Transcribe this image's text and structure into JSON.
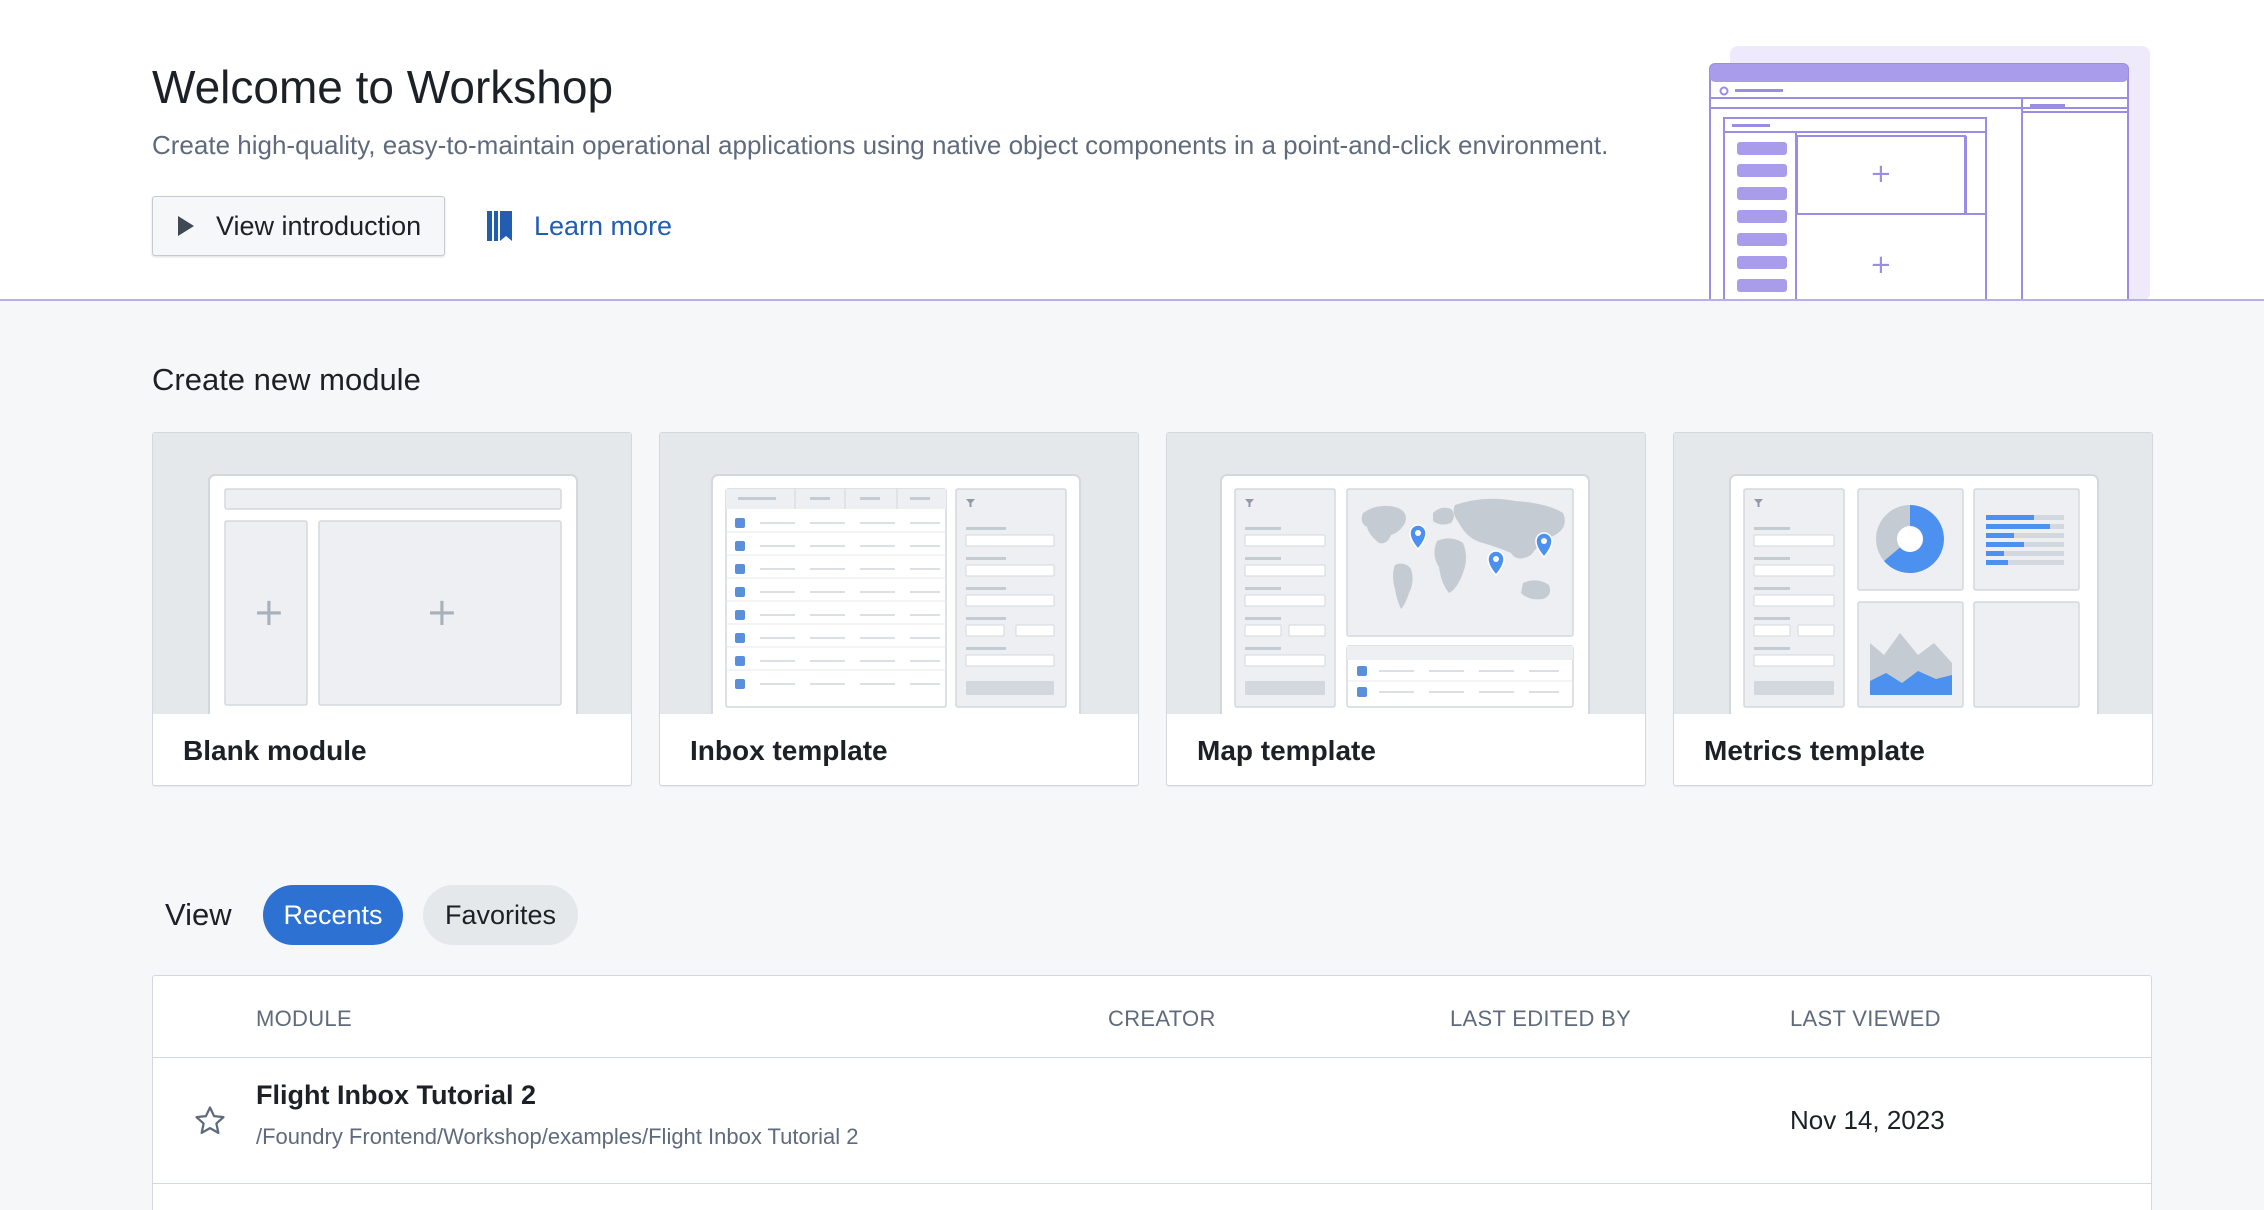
{
  "header": {
    "title": "Welcome to Workshop",
    "subtitle": "Create high-quality, easy-to-maintain operational applications using native object components in a point-and-click environment.",
    "intro_button": "View introduction",
    "learn_more": "Learn more",
    "icons": {
      "intro": "play-icon",
      "learn_more": "book-icon"
    },
    "accent_color": "#9b8ce6"
  },
  "create": {
    "title": "Create new module",
    "cards": [
      {
        "label": "Blank module"
      },
      {
        "label": "Inbox template"
      },
      {
        "label": "Map template"
      },
      {
        "label": "Metrics template"
      }
    ]
  },
  "view": {
    "label": "View",
    "tabs": [
      {
        "label": "Recents",
        "selected": true
      },
      {
        "label": "Favorites",
        "selected": false
      }
    ],
    "selected_color": "#2d72d2"
  },
  "table": {
    "columns": [
      "MODULE",
      "CREATOR",
      "LAST EDITED BY",
      "LAST VIEWED"
    ],
    "rows": [
      {
        "title": "Flight Inbox Tutorial 2",
        "path": "/Foundry Frontend/Workshop/examples/Flight Inbox Tutorial 2",
        "creator": "",
        "last_edited_by": "",
        "last_viewed": "Nov 14, 2023",
        "favorite": false
      }
    ]
  }
}
